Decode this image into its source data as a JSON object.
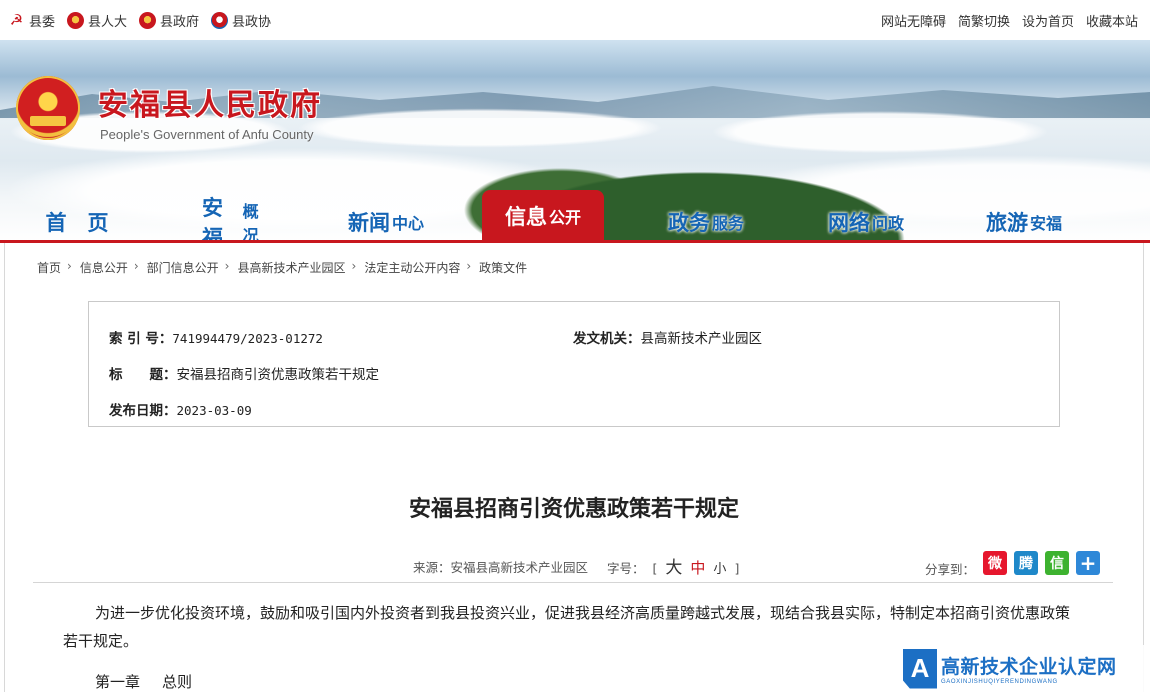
{
  "topbar": {
    "left_links": [
      {
        "label": "县委",
        "icon": "party-emblem-icon"
      },
      {
        "label": "县人大",
        "icon": "national-emblem-icon"
      },
      {
        "label": "县政府",
        "icon": "national-emblem-icon"
      },
      {
        "label": "县政协",
        "icon": "cppcc-emblem-icon"
      }
    ],
    "right_links": [
      "网站无障碍",
      "简繁切换",
      "设为首页",
      "收藏本站"
    ]
  },
  "header": {
    "title": "安福县人民政府",
    "subtitle": "People's Government of Anfu County"
  },
  "nav": {
    "items": [
      {
        "a": "首　页",
        "b": ""
      },
      {
        "a": "安福",
        "b": "概况"
      },
      {
        "a": "新闻",
        "b": "中心"
      },
      {
        "a": "信息",
        "b": "公开"
      },
      {
        "a": "政务",
        "b": "服务"
      },
      {
        "a": "网络",
        "b": "问政"
      },
      {
        "a": "旅游",
        "b": "安福"
      }
    ],
    "active_index": 3
  },
  "breadcrumb": [
    "首页",
    "信息公开",
    "部门信息公开",
    "县高新技术产业园区",
    "法定主动公开内容",
    "政策文件"
  ],
  "meta": {
    "index_label": "索 引 号：",
    "index_value": "741994479/2023-01272",
    "issuer_label": "发文机关：",
    "issuer_value": "县高新技术产业园区",
    "title_label": "标　　题：",
    "title_value": "安福县招商引资优惠政策若干规定",
    "date_label": "发布日期：",
    "date_value": "2023-03-09"
  },
  "document": {
    "title": "安福县招商引资优惠政策若干规定",
    "source": "来源：安福县高新技术产业园区",
    "font_size_label": "字号：",
    "font_bracket_open": "[",
    "font_big": "大",
    "font_mid": "中",
    "font_small": "小",
    "font_bracket_close": "]",
    "share_label": "分享到：",
    "paragraph": "为进一步优化投资环境，鼓励和吸引国内外投资者到我县投资兴业，促进我县经济高质量跨越式发展，现结合我县实际，特制定本招商引资优惠政策若干规定。",
    "chapter_num": "第一章",
    "chapter_title": "总则"
  },
  "share_buttons": [
    {
      "name": "weibo-icon",
      "glyph": "微",
      "color": "#e6162d"
    },
    {
      "name": "tencent-weibo-icon",
      "glyph": "腾",
      "color": "#1e88c9"
    },
    {
      "name": "wechat-icon",
      "glyph": "信",
      "color": "#3db22f"
    },
    {
      "name": "more-share-icon",
      "glyph": "+",
      "color": "#2e88d8"
    }
  ],
  "watermark": {
    "logo": "A",
    "cn": "高新技术企业认定网",
    "en": "GAOXINJISHUQIYERENDINGWANG"
  },
  "colors": {
    "brand_red": "#c8171e",
    "nav_blue": "#1565b5",
    "watermark_blue": "#1c6fc4"
  }
}
